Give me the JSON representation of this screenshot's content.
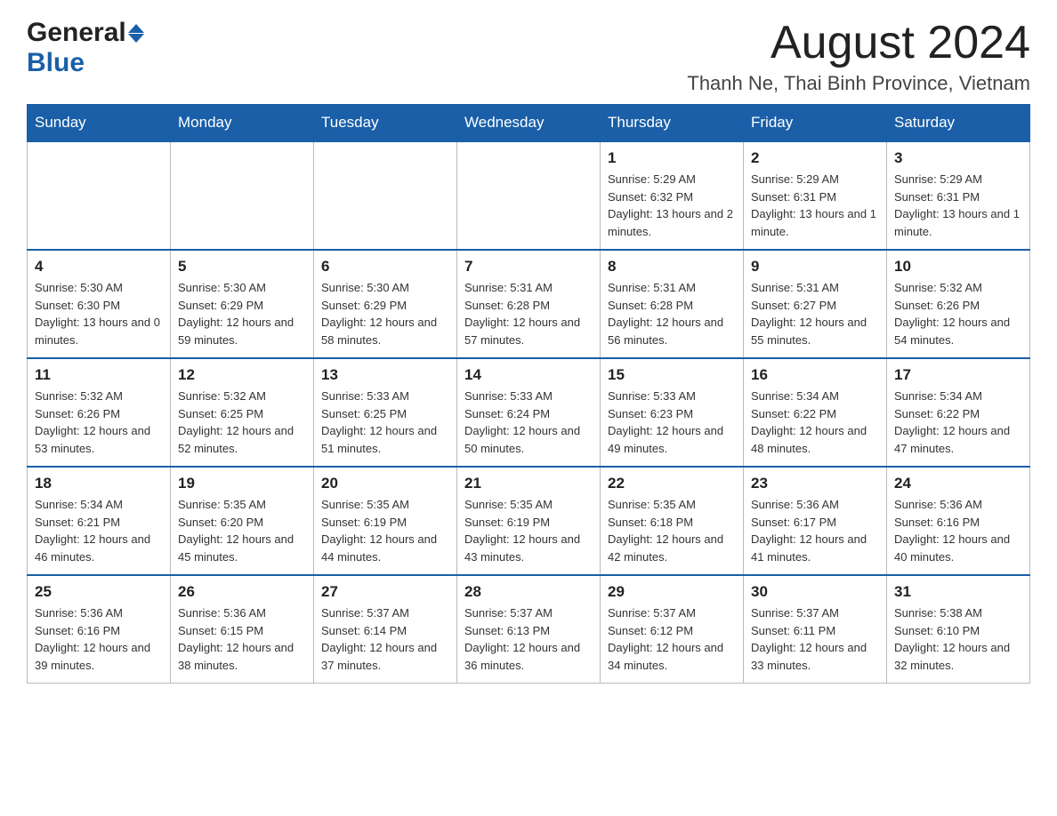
{
  "header": {
    "logo_general": "General",
    "logo_blue": "Blue",
    "month_title": "August 2024",
    "location": "Thanh Ne, Thai Binh Province, Vietnam"
  },
  "days_of_week": [
    "Sunday",
    "Monday",
    "Tuesday",
    "Wednesday",
    "Thursday",
    "Friday",
    "Saturday"
  ],
  "weeks": [
    {
      "days": [
        {
          "number": "",
          "detail": ""
        },
        {
          "number": "",
          "detail": ""
        },
        {
          "number": "",
          "detail": ""
        },
        {
          "number": "",
          "detail": ""
        },
        {
          "number": "1",
          "detail": "Sunrise: 5:29 AM\nSunset: 6:32 PM\nDaylight: 13 hours and 2 minutes."
        },
        {
          "number": "2",
          "detail": "Sunrise: 5:29 AM\nSunset: 6:31 PM\nDaylight: 13 hours and 1 minute."
        },
        {
          "number": "3",
          "detail": "Sunrise: 5:29 AM\nSunset: 6:31 PM\nDaylight: 13 hours and 1 minute."
        }
      ]
    },
    {
      "days": [
        {
          "number": "4",
          "detail": "Sunrise: 5:30 AM\nSunset: 6:30 PM\nDaylight: 13 hours and 0 minutes."
        },
        {
          "number": "5",
          "detail": "Sunrise: 5:30 AM\nSunset: 6:29 PM\nDaylight: 12 hours and 59 minutes."
        },
        {
          "number": "6",
          "detail": "Sunrise: 5:30 AM\nSunset: 6:29 PM\nDaylight: 12 hours and 58 minutes."
        },
        {
          "number": "7",
          "detail": "Sunrise: 5:31 AM\nSunset: 6:28 PM\nDaylight: 12 hours and 57 minutes."
        },
        {
          "number": "8",
          "detail": "Sunrise: 5:31 AM\nSunset: 6:28 PM\nDaylight: 12 hours and 56 minutes."
        },
        {
          "number": "9",
          "detail": "Sunrise: 5:31 AM\nSunset: 6:27 PM\nDaylight: 12 hours and 55 minutes."
        },
        {
          "number": "10",
          "detail": "Sunrise: 5:32 AM\nSunset: 6:26 PM\nDaylight: 12 hours and 54 minutes."
        }
      ]
    },
    {
      "days": [
        {
          "number": "11",
          "detail": "Sunrise: 5:32 AM\nSunset: 6:26 PM\nDaylight: 12 hours and 53 minutes."
        },
        {
          "number": "12",
          "detail": "Sunrise: 5:32 AM\nSunset: 6:25 PM\nDaylight: 12 hours and 52 minutes."
        },
        {
          "number": "13",
          "detail": "Sunrise: 5:33 AM\nSunset: 6:25 PM\nDaylight: 12 hours and 51 minutes."
        },
        {
          "number": "14",
          "detail": "Sunrise: 5:33 AM\nSunset: 6:24 PM\nDaylight: 12 hours and 50 minutes."
        },
        {
          "number": "15",
          "detail": "Sunrise: 5:33 AM\nSunset: 6:23 PM\nDaylight: 12 hours and 49 minutes."
        },
        {
          "number": "16",
          "detail": "Sunrise: 5:34 AM\nSunset: 6:22 PM\nDaylight: 12 hours and 48 minutes."
        },
        {
          "number": "17",
          "detail": "Sunrise: 5:34 AM\nSunset: 6:22 PM\nDaylight: 12 hours and 47 minutes."
        }
      ]
    },
    {
      "days": [
        {
          "number": "18",
          "detail": "Sunrise: 5:34 AM\nSunset: 6:21 PM\nDaylight: 12 hours and 46 minutes."
        },
        {
          "number": "19",
          "detail": "Sunrise: 5:35 AM\nSunset: 6:20 PM\nDaylight: 12 hours and 45 minutes."
        },
        {
          "number": "20",
          "detail": "Sunrise: 5:35 AM\nSunset: 6:19 PM\nDaylight: 12 hours and 44 minutes."
        },
        {
          "number": "21",
          "detail": "Sunrise: 5:35 AM\nSunset: 6:19 PM\nDaylight: 12 hours and 43 minutes."
        },
        {
          "number": "22",
          "detail": "Sunrise: 5:35 AM\nSunset: 6:18 PM\nDaylight: 12 hours and 42 minutes."
        },
        {
          "number": "23",
          "detail": "Sunrise: 5:36 AM\nSunset: 6:17 PM\nDaylight: 12 hours and 41 minutes."
        },
        {
          "number": "24",
          "detail": "Sunrise: 5:36 AM\nSunset: 6:16 PM\nDaylight: 12 hours and 40 minutes."
        }
      ]
    },
    {
      "days": [
        {
          "number": "25",
          "detail": "Sunrise: 5:36 AM\nSunset: 6:16 PM\nDaylight: 12 hours and 39 minutes."
        },
        {
          "number": "26",
          "detail": "Sunrise: 5:36 AM\nSunset: 6:15 PM\nDaylight: 12 hours and 38 minutes."
        },
        {
          "number": "27",
          "detail": "Sunrise: 5:37 AM\nSunset: 6:14 PM\nDaylight: 12 hours and 37 minutes."
        },
        {
          "number": "28",
          "detail": "Sunrise: 5:37 AM\nSunset: 6:13 PM\nDaylight: 12 hours and 36 minutes."
        },
        {
          "number": "29",
          "detail": "Sunrise: 5:37 AM\nSunset: 6:12 PM\nDaylight: 12 hours and 34 minutes."
        },
        {
          "number": "30",
          "detail": "Sunrise: 5:37 AM\nSunset: 6:11 PM\nDaylight: 12 hours and 33 minutes."
        },
        {
          "number": "31",
          "detail": "Sunrise: 5:38 AM\nSunset: 6:10 PM\nDaylight: 12 hours and 32 minutes."
        }
      ]
    }
  ]
}
